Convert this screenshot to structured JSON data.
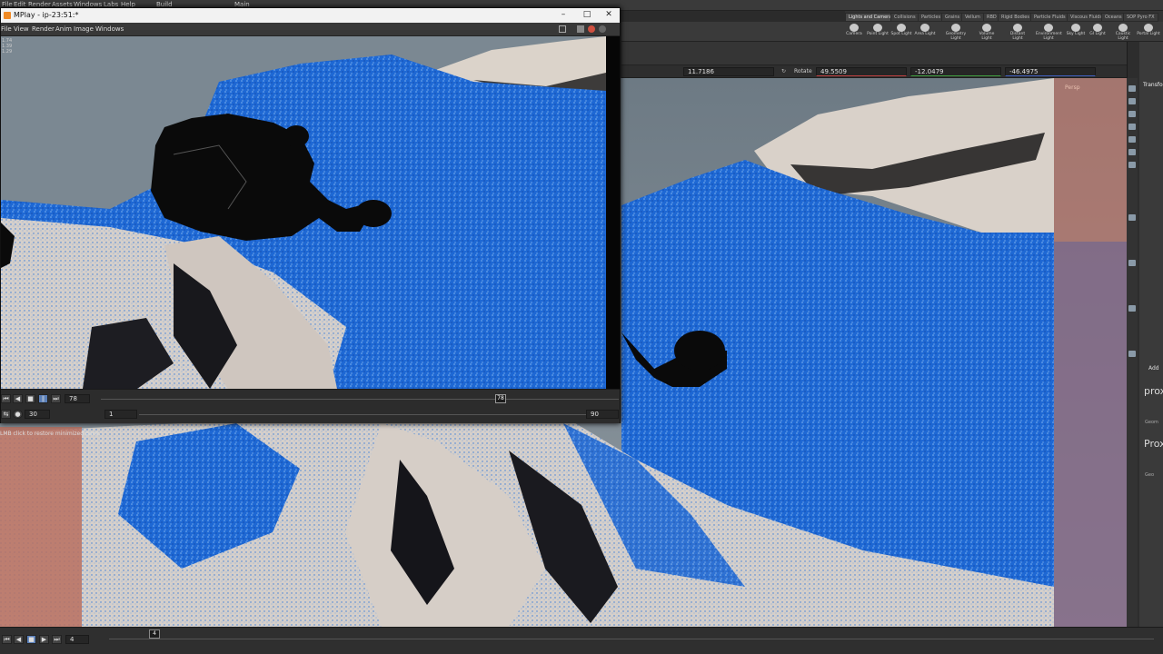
{
  "main_menu": [
    "File",
    "Edit",
    "Render",
    "Assets",
    "Windows",
    "Labs",
    "Help"
  ],
  "main_tabs": [
    "Build",
    "Main"
  ],
  "desk_tabs": [
    "Lights and Cameras",
    "Collisions",
    "Particles",
    "Grains",
    "Vellum",
    "RBD",
    "Rigid Bodies",
    "Particle Fluids",
    "Viscous Fluids",
    "Oceans",
    "SOP Pyro FX"
  ],
  "shelf_tools": [
    "Camera",
    "Point Light",
    "Spot Light",
    "Area Light",
    "Geometry Light",
    "Volume Light",
    "Distant Light",
    "Environment Light",
    "Sky Light",
    "GI Light",
    "Caustic Light",
    "Portal Light"
  ],
  "transform": {
    "tx": "11.7186",
    "rotate_label": "Rotate",
    "rx": "49.5509",
    "ry": "-12.0479",
    "rz": "-46.4975"
  },
  "persp_label": "Persp",
  "mplay": {
    "title": "MPlay - ip-23:51:*",
    "menu": [
      "File",
      "View",
      "Render",
      "Anim",
      "Image",
      "Windows"
    ],
    "res_text": "1.74\n1.39\n1.29",
    "frame": "78",
    "frame_marker": "78",
    "fps": "30",
    "start": "1",
    "end": "90"
  },
  "minimized_hint": "LMB click to restore minimized pane.",
  "timeline": {
    "frame": "4",
    "marker": "4"
  },
  "right_panel": {
    "param_tab": "Transfo",
    "add_label": "Add",
    "proxy_1": "prox",
    "proxy_2": "Prox",
    "geo_1": "Geom",
    "geo_2": "Geo"
  },
  "colors": {
    "water": "#1f6fd8",
    "water_light": "#63a4ec",
    "rock": "#d8d2cc",
    "sky": "#7f8a92",
    "char": "#0a0a0a"
  }
}
